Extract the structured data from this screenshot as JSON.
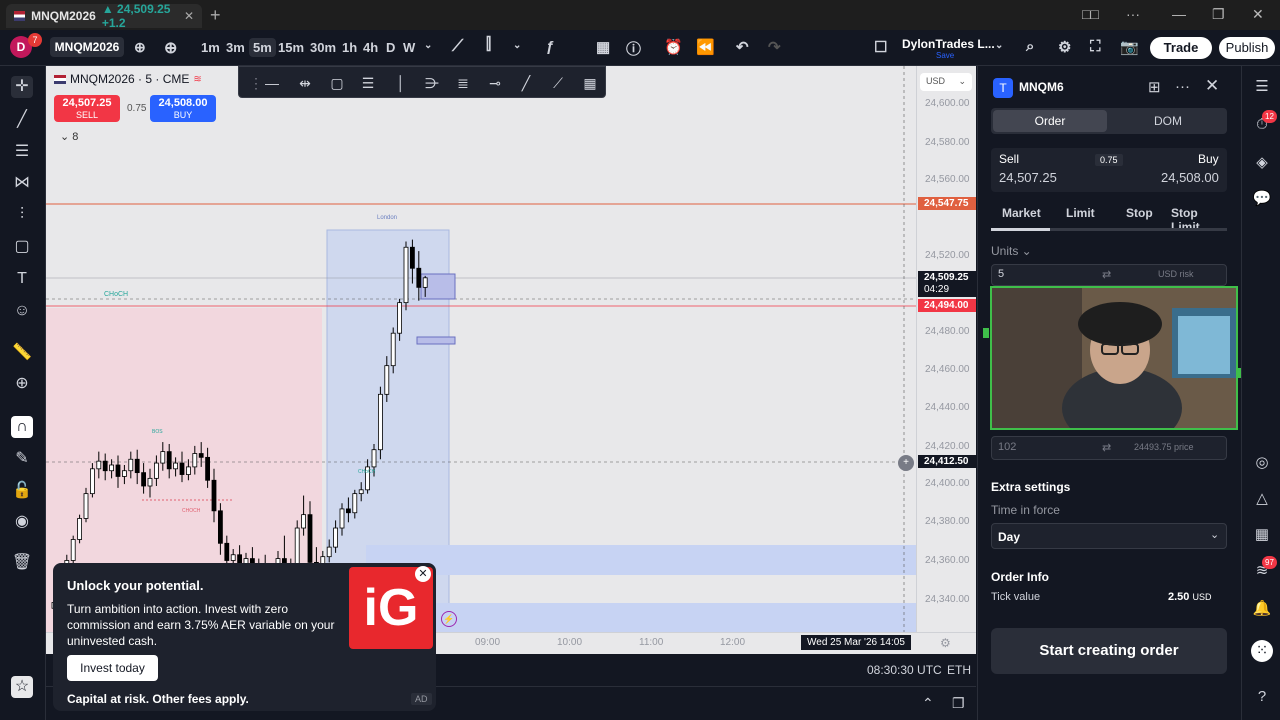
{
  "browser": {
    "tab_title": "MNQM2026",
    "tab_change": "▲ 24,509.25 +1.2",
    "new_tab": "+",
    "window_buttons": [
      "□□",
      "···",
      "—",
      "❐",
      "✕"
    ]
  },
  "toolbar": {
    "avatar_letter": "D",
    "avatar_badge": "7",
    "symbol": "MNQM2026",
    "timeframes": [
      "1m",
      "3m",
      "5m",
      "15m",
      "30m",
      "1h",
      "4h",
      "D",
      "W"
    ],
    "active_timeframe": "5m",
    "layout_name": "DylonTrades L...",
    "layout_sub": "Save",
    "trade_label": "Trade",
    "publish_label": "Publish"
  },
  "chart": {
    "title": "MNQM2026 · 5 · CME",
    "sell_price": "24,507.25",
    "sell_label": "SELL",
    "spread": "0.75",
    "buy_price": "24,508.00",
    "buy_label": "BUY",
    "indicator_count": "8",
    "currency": "USD",
    "annotations": {
      "choch_1": "CHoCH",
      "london": "London",
      "bos": "BOS",
      "choch_2": "CHOCH",
      "choch_3": "CHoCH"
    },
    "price_ticks": [
      "24,600.00",
      "24,580.00",
      "24,560.00",
      "24,520.00",
      "24,480.00",
      "24,460.00",
      "24,440.00",
      "24,420.00",
      "24,400.00",
      "24,380.00",
      "24,360.00",
      "24,340.00"
    ],
    "price_labels": {
      "red_line": "24,547.75",
      "current": "24,509.25",
      "countdown": "04:29",
      "pink_line": "24,494.00",
      "crosshair": "24,412.50"
    },
    "time_ticks": [
      "09:00",
      "10:00",
      "11:00",
      "12:00"
    ],
    "crosshair_time": "Wed 25 Mar '26  14:05",
    "utc_time": "08:30:30 UTC",
    "session": "ETH",
    "candles": [
      {
        "o": 24336,
        "h": 24343,
        "c": 24339,
        "l": 24331
      },
      {
        "o": 24341,
        "h": 24349,
        "c": 24351,
        "l": 24338
      },
      {
        "o": 24351,
        "h": 24364,
        "c": 24361,
        "l": 24349
      },
      {
        "o": 24361,
        "h": 24374,
        "c": 24372,
        "l": 24359
      },
      {
        "o": 24372,
        "h": 24385,
        "c": 24383,
        "l": 24370
      },
      {
        "o": 24383,
        "h": 24399,
        "c": 24396,
        "l": 24381
      },
      {
        "o": 24396,
        "h": 24412,
        "c": 24409,
        "l": 24394
      },
      {
        "o": 24409,
        "h": 24418,
        "c": 24413,
        "l": 24404
      },
      {
        "o": 24413,
        "h": 24417,
        "c": 24408,
        "l": 24403
      },
      {
        "o": 24408,
        "h": 24414,
        "c": 24411,
        "l": 24404
      },
      {
        "o": 24411,
        "h": 24416,
        "c": 24405,
        "l": 24399
      },
      {
        "o": 24405,
        "h": 24411,
        "c": 24408,
        "l": 24401
      },
      {
        "o": 24408,
        "h": 24418,
        "c": 24414,
        "l": 24404
      },
      {
        "o": 24414,
        "h": 24419,
        "c": 24407,
        "l": 24401
      },
      {
        "o": 24407,
        "h": 24412,
        "c": 24400,
        "l": 24396
      },
      {
        "o": 24400,
        "h": 24409,
        "c": 24404,
        "l": 24394
      },
      {
        "o": 24404,
        "h": 24416,
        "c": 24412,
        "l": 24400
      },
      {
        "o": 24412,
        "h": 24423,
        "c": 24418,
        "l": 24408
      },
      {
        "o": 24418,
        "h": 24422,
        "c": 24409,
        "l": 24404
      },
      {
        "o": 24409,
        "h": 24415,
        "c": 24412,
        "l": 24405
      },
      {
        "o": 24412,
        "h": 24418,
        "c": 24406,
        "l": 24402
      },
      {
        "o": 24406,
        "h": 24414,
        "c": 24410,
        "l": 24403
      },
      {
        "o": 24410,
        "h": 24421,
        "c": 24417,
        "l": 24406
      },
      {
        "o": 24417,
        "h": 24423,
        "c": 24415,
        "l": 24410
      },
      {
        "o": 24415,
        "h": 24420,
        "c": 24403,
        "l": 24399
      },
      {
        "o": 24403,
        "h": 24409,
        "c": 24387,
        "l": 24381
      },
      {
        "o": 24387,
        "h": 24391,
        "c": 24370,
        "l": 24364
      },
      {
        "o": 24370,
        "h": 24374,
        "c": 24361,
        "l": 24357
      },
      {
        "o": 24361,
        "h": 24367,
        "c": 24364,
        "l": 24356
      },
      {
        "o": 24364,
        "h": 24369,
        "c": 24358,
        "l": 24353
      },
      {
        "o": 24358,
        "h": 24365,
        "c": 24362,
        "l": 24354
      },
      {
        "o": 24362,
        "h": 24368,
        "c": 24356,
        "l": 24350
      },
      {
        "o": 24356,
        "h": 24362,
        "c": 24359,
        "l": 24351
      },
      {
        "o": 24359,
        "h": 24364,
        "c": 24353,
        "l": 24348
      },
      {
        "o": 24353,
        "h": 24358,
        "c": 24355,
        "l": 24349
      },
      {
        "o": 24355,
        "h": 24366,
        "c": 24362,
        "l": 24352
      },
      {
        "o": 24362,
        "h": 24374,
        "c": 24357,
        "l": 24353
      },
      {
        "o": 24357,
        "h": 24362,
        "c": 24349,
        "l": 24344
      },
      {
        "o": 24349,
        "h": 24382,
        "c": 24378,
        "l": 24346
      },
      {
        "o": 24378,
        "h": 24395,
        "c": 24385,
        "l": 24374
      },
      {
        "o": 24385,
        "h": 24392,
        "c": 24360,
        "l": 24354
      },
      {
        "o": 24360,
        "h": 24368,
        "c": 24356,
        "l": 24349
      },
      {
        "o": 24356,
        "h": 24366,
        "c": 24363,
        "l": 24352
      },
      {
        "o": 24363,
        "h": 24372,
        "c": 24368,
        "l": 24360
      },
      {
        "o": 24368,
        "h": 24382,
        "c": 24378,
        "l": 24365
      },
      {
        "o": 24378,
        "h": 24391,
        "c": 24388,
        "l": 24374
      },
      {
        "o": 24388,
        "h": 24394,
        "c": 24386,
        "l": 24381
      },
      {
        "o": 24386,
        "h": 24398,
        "c": 24396,
        "l": 24383
      },
      {
        "o": 24396,
        "h": 24402,
        "c": 24398,
        "l": 24392
      },
      {
        "o": 24398,
        "h": 24414,
        "c": 24410,
        "l": 24396
      },
      {
        "o": 24410,
        "h": 24422,
        "c": 24419,
        "l": 24405
      },
      {
        "o": 24419,
        "h": 24452,
        "c": 24448,
        "l": 24414
      },
      {
        "o": 24448,
        "h": 24468,
        "c": 24463,
        "l": 24444
      },
      {
        "o": 24463,
        "h": 24483,
        "c": 24480,
        "l": 24459
      },
      {
        "o": 24480,
        "h": 24498,
        "c": 24496,
        "l": 24476
      },
      {
        "o": 24496,
        "h": 24528,
        "c": 24525,
        "l": 24492
      },
      {
        "o": 24525,
        "h": 24529,
        "c": 24514,
        "l": 24506
      },
      {
        "o": 24514,
        "h": 24523,
        "c": 24504,
        "l": 24497
      },
      {
        "o": 24504,
        "h": 24510,
        "c": 24509,
        "l": 24499
      }
    ]
  },
  "drawing_toolbar": [
    "—",
    "⇹",
    "▢",
    "☰",
    "│",
    "⋺",
    "≣",
    "⊸",
    "╱",
    "⟋",
    "▦"
  ],
  "ad": {
    "title": "Unlock your potential.",
    "body": "Turn ambition into action. Invest with zero commission and earn 3.75% AER variable on your uninvested cash.",
    "cta": "Invest today",
    "footer": "Capital at risk. Other fees apply.",
    "logo": "iG",
    "tag": "AD"
  },
  "order_panel": {
    "symbol": "MNQM6",
    "tab_order": "Order",
    "tab_dom": "DOM",
    "sell_label": "Sell",
    "sell_price": "24,507.25",
    "spread": "0.75",
    "buy_label": "Buy",
    "buy_price": "24,508.00",
    "order_types": [
      "Market",
      "Limit",
      "Stop",
      "Stop Limit"
    ],
    "units_label": "Units",
    "units_value": "5",
    "units_mode": "USD risk",
    "price_field_value": "102",
    "price_field_hint": "24493.75 price",
    "extra_settings": "Extra settings",
    "tif_label": "Time in force",
    "tif_value": "Day",
    "order_info": "Order Info",
    "tick_label": "Tick value",
    "tick_value": "2.50",
    "tick_currency": "USD",
    "submit": "Start creating order"
  },
  "right_sidebar": {
    "badge_alerts": "12",
    "badge_news": "97"
  },
  "colors": {
    "accent_blue": "#2962ff",
    "sell_red": "#f23645",
    "webcam_border": "#3fbf4a",
    "line_red": "#e06040"
  }
}
